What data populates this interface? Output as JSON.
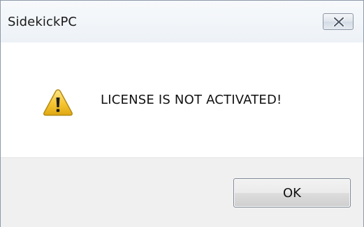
{
  "window": {
    "title": "SidekickPC"
  },
  "titlebar_buttons": {
    "close_icon": "close-icon"
  },
  "message": {
    "icon": "warning-icon",
    "text": "LICENSE IS NOT ACTIVATED!"
  },
  "buttons": {
    "ok_label": "OK"
  },
  "colors": {
    "warning_yellow": "#f5c531",
    "warning_border": "#b48a12",
    "footer_bg": "#f0f0f0"
  }
}
